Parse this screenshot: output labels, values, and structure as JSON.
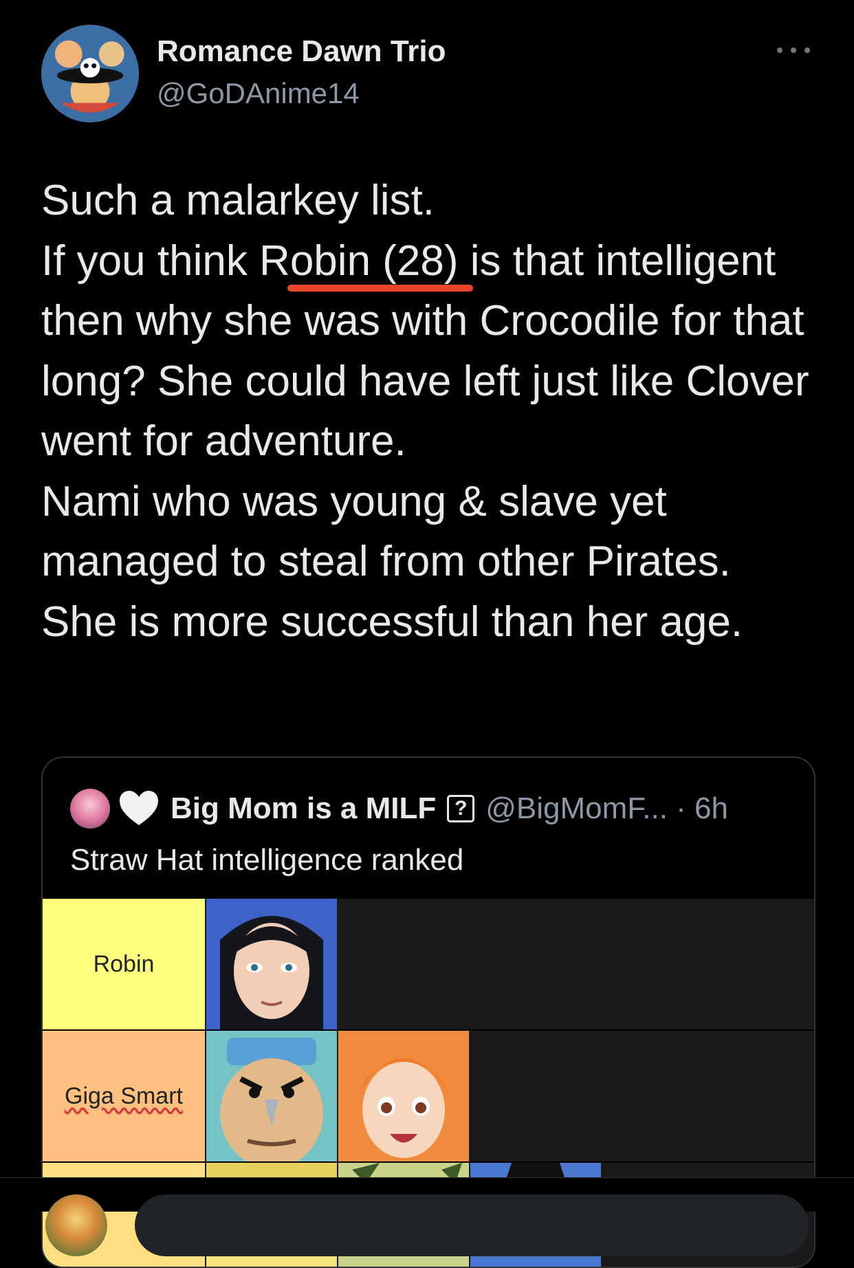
{
  "tweet": {
    "author_name": "Romance Dawn Trio",
    "author_handle": "@GoDAnime14",
    "text": "Such a malarkey list.\nIf you think Robin (28) is that intelligent then why she was with Crocodile for that long? She could have left just like Clover went for adventure.\nNami who was young & slave yet managed to steal from other Pirates.\nShe is more successful than her age."
  },
  "quote": {
    "author_name": "Big Mom is a MILF",
    "qbox_glyph": "?",
    "handle_time": "@BigMomF... · 6h",
    "text": "Straw Hat intelligence ranked",
    "tiers": [
      {
        "label": "Robin",
        "color": "#ffff7f",
        "images": [
          "robin-portrait"
        ]
      },
      {
        "label": "Giga Smart",
        "color": "#ffbf7f",
        "images": [
          "franky-portrait",
          "nami-portrait"
        ]
      },
      {
        "label": "",
        "color": "#ffdf7f",
        "images": [
          "sanji-portrait",
          "chopper-portrait",
          "luffy-portrait"
        ]
      }
    ]
  },
  "icons": [
    "more-options-icon",
    "white-heart-icon",
    "question-box-icon"
  ]
}
